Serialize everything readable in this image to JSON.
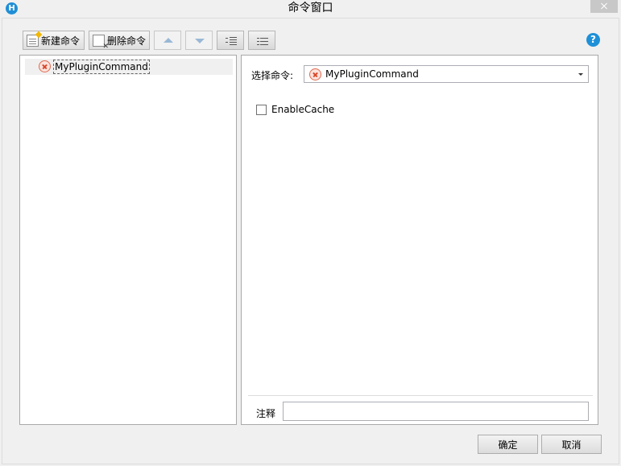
{
  "window": {
    "title": "命令窗口",
    "app_icon_letter": "H"
  },
  "toolbar": {
    "new_command_label": "新建命令",
    "delete_command_label": "删除命令"
  },
  "tree": {
    "items": [
      {
        "label": "MyPluginCommand"
      }
    ]
  },
  "editor": {
    "select_label": "选择命令:",
    "selected_command": "MyPluginCommand",
    "option_label": "EnableCache",
    "option_checked": false,
    "note_label": "注释",
    "note_value": ""
  },
  "footer": {
    "ok_label": "确定",
    "cancel_label": "取消"
  },
  "icons": {
    "help": "?",
    "error_color": "#d9472a",
    "help_color": "#1e90d8"
  }
}
